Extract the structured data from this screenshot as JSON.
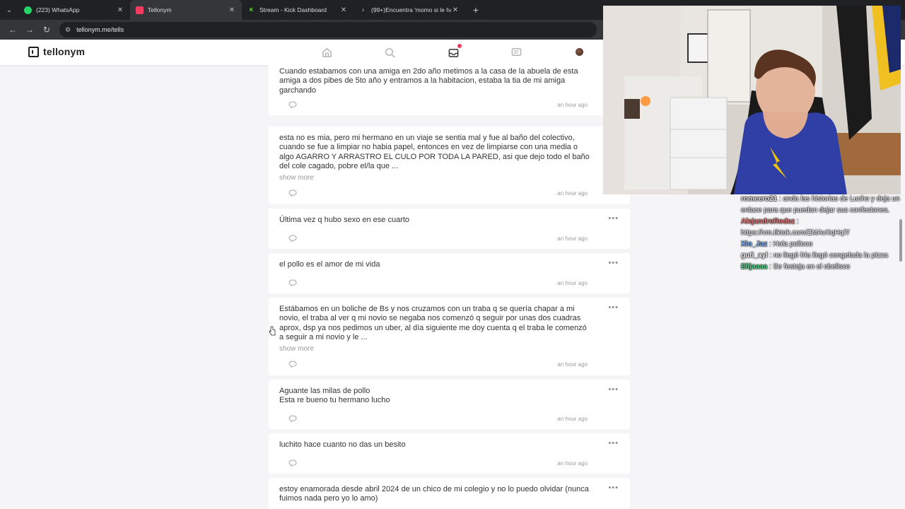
{
  "browser": {
    "tabs": [
      {
        "label": "(223) WhatsApp",
        "icon": "whatsapp-icon",
        "color": "#25d366"
      },
      {
        "label": "Tellonym",
        "icon": "tellonym-icon",
        "color": "#f13c5f",
        "active": true
      },
      {
        "label": "Stream - Kick Dashboard",
        "icon": "kick-icon",
        "color": "#53fc18"
      },
      {
        "label": "(99+)Encuentra 'momo si le ha",
        "icon": "tiktok-icon",
        "color": "#ffffff"
      }
    ],
    "url": "tellonym.me/tells"
  },
  "header": {
    "logo_text": "tellonym",
    "nav_icons": [
      "home-icon",
      "search-icon",
      "inbox-icon",
      "chat-icon",
      "avatar"
    ],
    "accent": "#f13c5f"
  },
  "tells": [
    {
      "text": "Cuando estabamos con una amiga en 2do año metimos a la casa de la abuela de esta amiga a dos pibes de 5to año y entramos a la habitacion, estaba la tia de mi amiga garchando",
      "time": "an hour ago",
      "show_more": ""
    },
    {
      "text": "esta no es mia, pero mi hermano en un viaje se sentia mal y fue al baño del colectivo, cuando se fue a limpiar no habia papel, entonces en vez de limpiarse con una media o algo AGARRO Y ARRASTRO EL CULO POR TODA LA PARED, asi que dejo todo el baño del cole cagado, pobre el/la que ...",
      "time": "an hour ago",
      "show_more": "show more"
    },
    {
      "text": "Última vez q hubo sexo en ese cuarto",
      "time": "an hour ago",
      "show_more": ""
    },
    {
      "text": "el pollo es el amor de mi vida",
      "time": "an hour ago",
      "show_more": ""
    },
    {
      "text": "Estábamos en un boliche de Bs y nos cruzamos con un traba q se quería chapar a mi novio, el traba al ver q mi novio se negaba nos comenzó q seguir por unas dos cuadras aprox, dsp ya nos pedimos un uber, al día siguiente me doy cuenta q el traba le comenzó a seguir a mi novio y le ...",
      "time": "an hour ago",
      "show_more": "show more"
    },
    {
      "text": "Aguante las milas de pollo\nEsta re bueno tu hermano lucho",
      "time": "an hour ago",
      "show_more": ""
    },
    {
      "text": "luchito hace cuanto no das un besito",
      "time": "an hour ago",
      "show_more": ""
    },
    {
      "text": "estoy enamorada desde abril 2024 de un chico de mi colegio y no lo puedo olvidar (nunca fuimos nada pero yo lo amo)",
      "time": "",
      "show_more": ""
    }
  ],
  "chat": [
    {
      "user": "romeero21",
      "color": "#e8e8e8",
      "message": "anda las historias de Lucho y deja un enlace para que puedan dejar sus confesiones."
    },
    {
      "user": "AlejandroRodez",
      "color": "#f08080",
      "message": "https://vm.tiktok.com/ZMAvXqHq7/"
    },
    {
      "user": "Xio_Jaz",
      "color": "#7eb6ff",
      "message": "Hola pollooo"
    },
    {
      "user": "guti_ayl",
      "color": "#ffffff",
      "message": "no llegó fría llegó congelada la pizza"
    },
    {
      "user": "Elijaaaa",
      "color": "#4ce38b",
      "message": "Se festeja en el obelisco"
    }
  ]
}
